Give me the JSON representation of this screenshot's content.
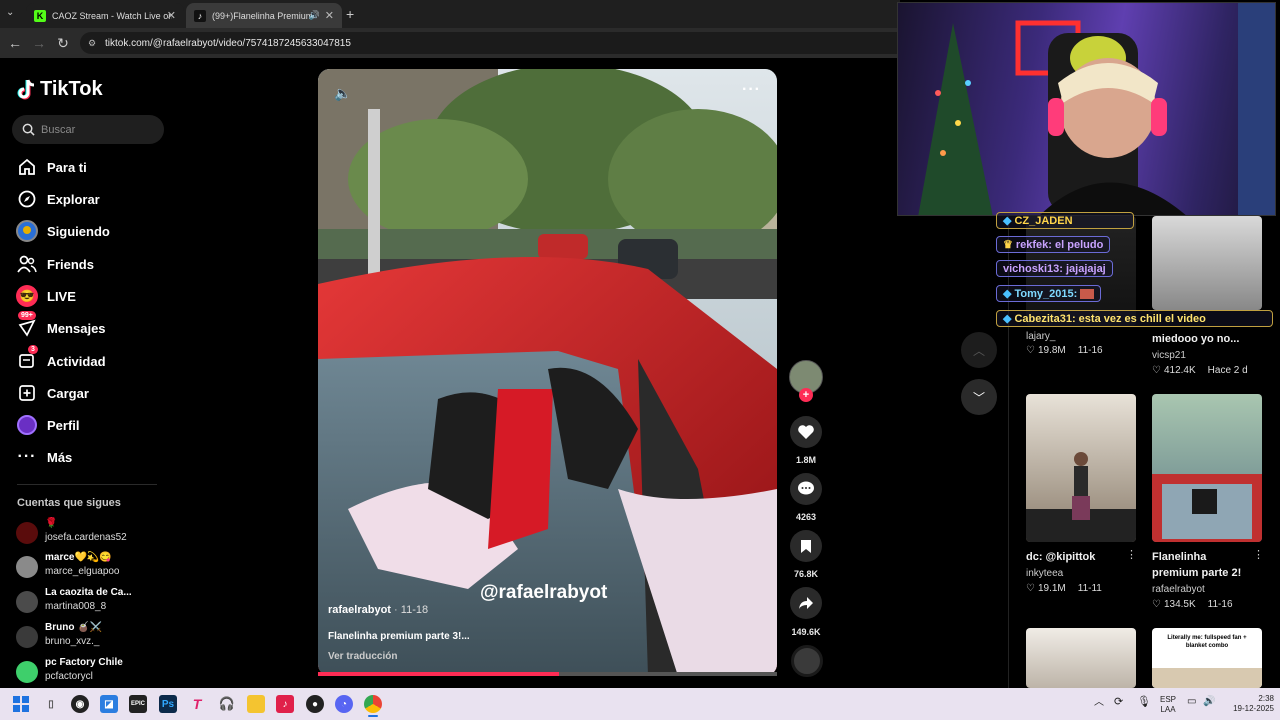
{
  "browser": {
    "tabs": [
      {
        "title": "CAOZ Stream - Watch Live on K",
        "favicon": "kick-icon",
        "color": "#53fc18"
      },
      {
        "title": "(99+)Flanelinha Premium P",
        "favicon": "tiktok-icon",
        "active": true
      }
    ],
    "url": "tiktok.com/@rafaelrabyot/video/7574187245633047815"
  },
  "sidebar": {
    "logo": "TikTok",
    "search_placeholder": "Buscar",
    "nav": [
      {
        "label": "Para ti",
        "icon": "home-icon"
      },
      {
        "label": "Explorar",
        "icon": "compass-icon"
      },
      {
        "label": "Siguiendo",
        "icon": "following-icon"
      },
      {
        "label": "Friends",
        "icon": "friends-icon"
      },
      {
        "label": "LIVE",
        "icon": "live-icon"
      },
      {
        "label": "Mensajes",
        "icon": "messages-icon",
        "badge": "99+"
      },
      {
        "label": "Actividad",
        "icon": "activity-icon",
        "badge": "3"
      },
      {
        "label": "Cargar",
        "icon": "upload-icon"
      },
      {
        "label": "Perfil",
        "icon": "profile-icon"
      },
      {
        "label": "Más",
        "icon": "more-icon"
      }
    ],
    "following_title": "Cuentas que sigues",
    "following": [
      {
        "name": "🌹",
        "handle": "josefa.cardenas52",
        "color": "#7a1010"
      },
      {
        "name": "marce💛💫😋",
        "handle": "marce_elguapoo",
        "color": "#777"
      },
      {
        "name": "La caozita de Ca...",
        "handle": "martina008_8",
        "color": "#555"
      },
      {
        "name": "Bruno 🧉⚔️",
        "handle": "bruno_xvz._",
        "color": "#444"
      },
      {
        "name": "pc Factory Chile",
        "handle": "pcfactorycl",
        "color": "#3ecf6b"
      }
    ]
  },
  "video": {
    "author": "rafaelrabyot",
    "date": "11-18",
    "caption": "Flanelinha premium parte 3!...",
    "translate": "Ver traducción",
    "watermark": "@rafaelrabyot",
    "progress": 0.525,
    "actions": {
      "likes": "1.8M",
      "comments": "4263",
      "saves": "76.8K",
      "shares": "149.6K"
    }
  },
  "chat": [
    {
      "user": "CZ_JADEN",
      "text": "",
      "color": "#ffd54a"
    },
    {
      "user": "rekfek",
      "text": " : el peludo",
      "color": "#c9a3ff"
    },
    {
      "user": "vichoski13",
      "text": " : jajajajaj",
      "color": "#c9a3ff"
    },
    {
      "user": "Tomy_2015",
      "text": " : ",
      "color": "#7fd8ff"
    },
    {
      "user": "Cabezita31",
      "text": " : esta vez es chill el video",
      "color": "#ffe36e"
    }
  ],
  "grid": [
    {
      "title": "",
      "user": "lajary_",
      "stat": "19.8M",
      "date": "11-16"
    },
    {
      "title": "miedooo yo no...",
      "user": "vicsp21",
      "stat": "412.4K",
      "date": "Hace 2 d"
    },
    {
      "title": "dc: @kipittok",
      "user": "inkyteea",
      "stat": "19.1M",
      "date": "11-11"
    },
    {
      "title": "Flanelinha",
      "title2": "premium parte 2!",
      "user": "rafaelrabyot",
      "stat": "134.5K",
      "date": "11-16"
    },
    {
      "overlay": "Literally me: fullspeed fan + blanket combo"
    }
  ],
  "taskbar": {
    "lang": "ESP",
    "region": "LAA",
    "time": "2:38",
    "date": "19-12-2025"
  }
}
